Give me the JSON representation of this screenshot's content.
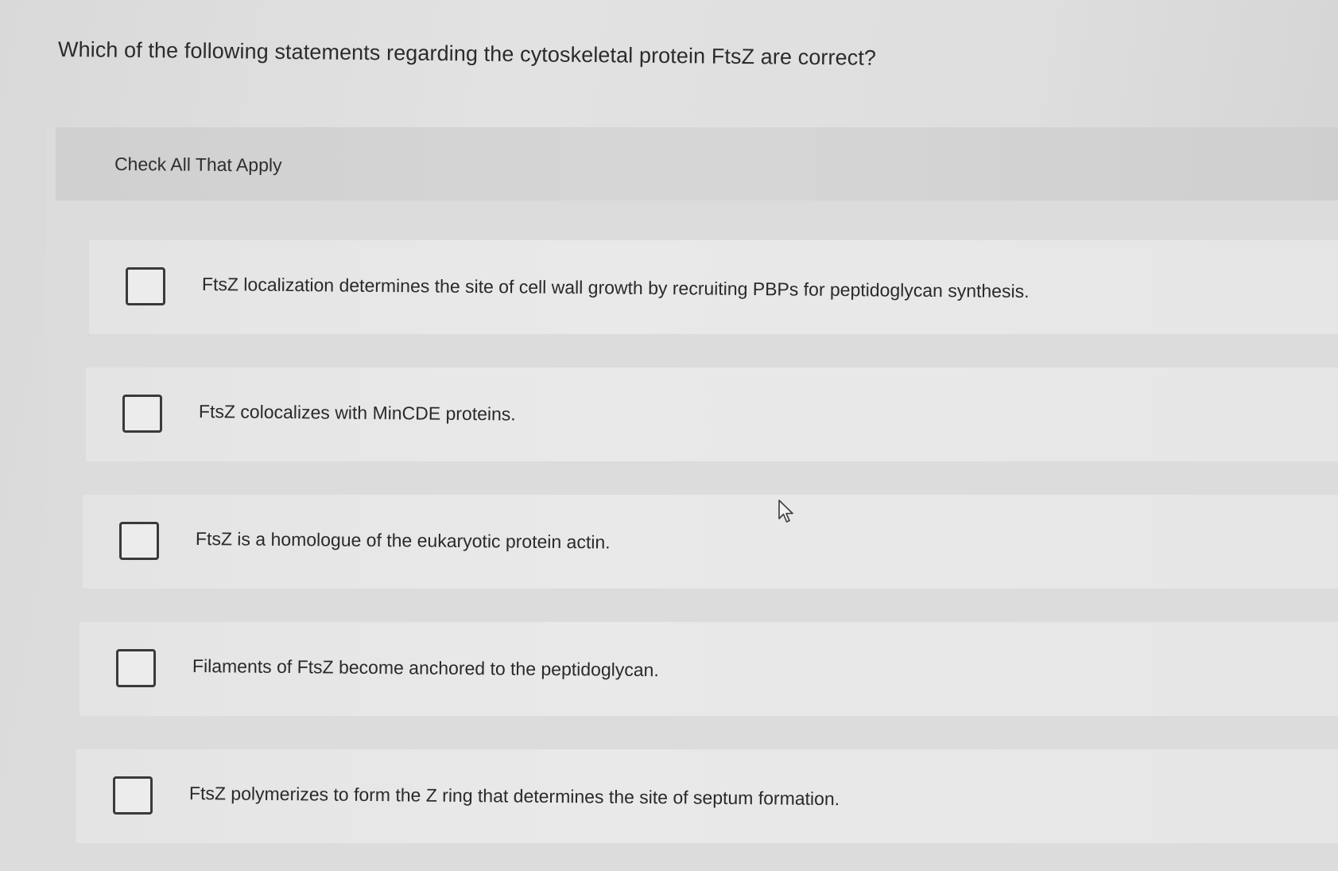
{
  "question": {
    "text": "Which of the following statements regarding the cytoskeletal protein FtsZ are correct?"
  },
  "instruction": "Check All That Apply",
  "options": [
    {
      "label": "FtsZ localization determines the site of cell wall growth by recruiting PBPs for peptidoglycan synthesis.",
      "checked": false
    },
    {
      "label": "FtsZ colocalizes with MinCDE proteins.",
      "checked": false
    },
    {
      "label": "FtsZ is a homologue of the eukaryotic protein actin.",
      "checked": false
    },
    {
      "label": "Filaments of FtsZ become anchored to the peptidoglycan.",
      "checked": false
    },
    {
      "label": "FtsZ polymerizes to form the Z ring that determines the site of septum formation.",
      "checked": false
    }
  ],
  "cursor": {
    "icon": "mouse-pointer-icon"
  }
}
